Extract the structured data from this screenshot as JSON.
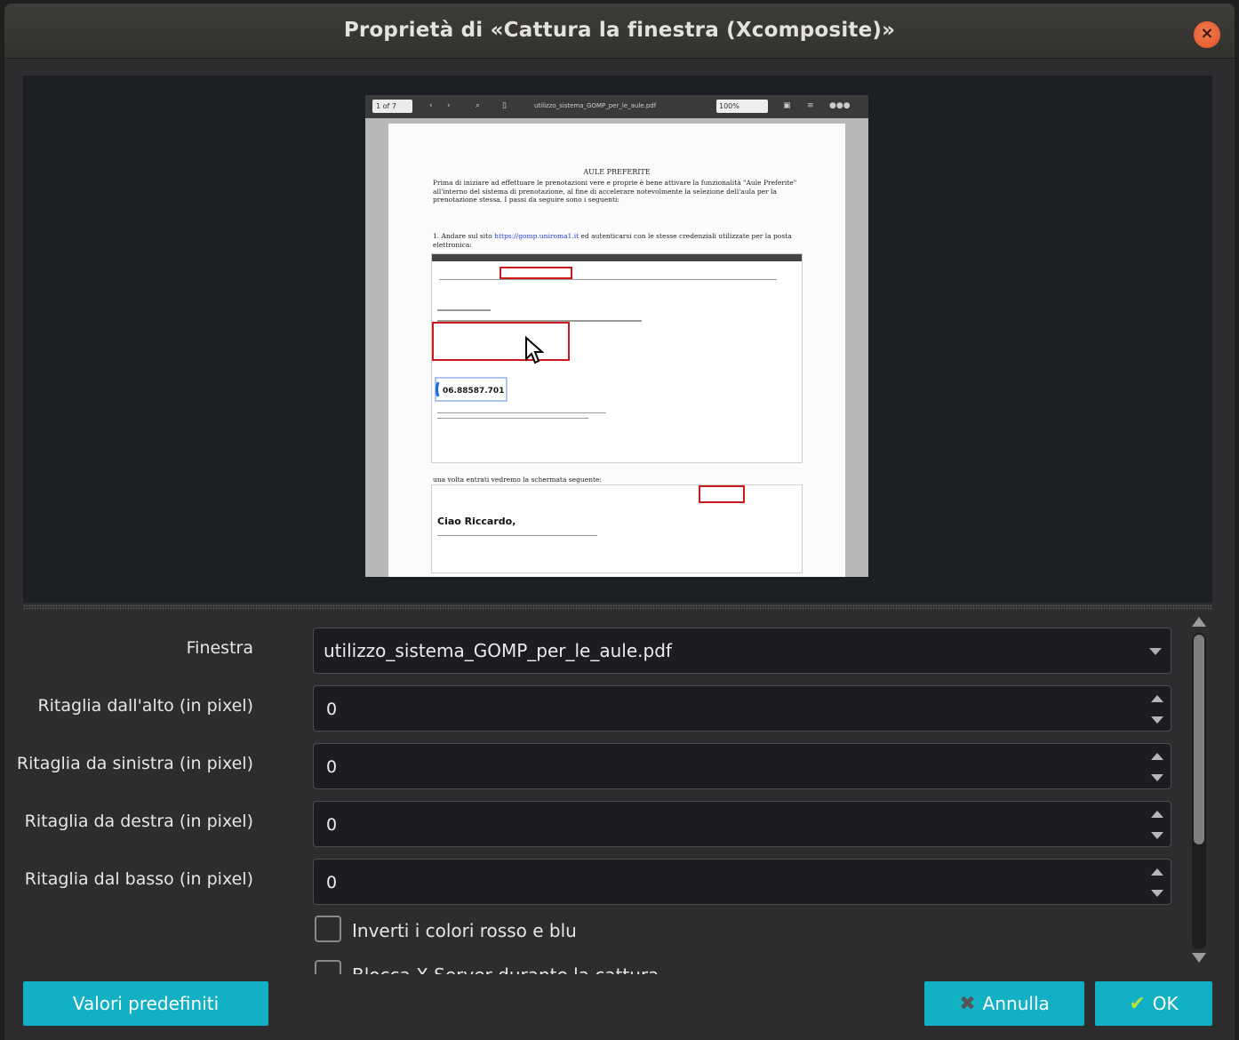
{
  "window": {
    "title": "Proprietà di «Cattura la finestra (Xcomposite)»"
  },
  "preview": {
    "toolbar": {
      "page": "1  of 7",
      "filename": "utilizzo_sistema_GOMP_per_le_aule.pdf",
      "zoom": "100%"
    },
    "document": {
      "heading": "AULE PREFERITE",
      "intro": "Prima di iniziare ad effettuare le prenotazioni vere e proprie è bene attivare la funzionalità \"Aule Preferite\" all'interno del sistema di prenotazione, al fine di accelerare notevolmente la selezione dell'aula per la prenotazione stessa. I passi da seguire sono i seguenti:",
      "step1_prefix": "1. Andare sul sito",
      "step1_link": "https://gomp.uniroma1.it",
      "step1_suffix": "ed autenticarsi con le stesse credenziali utilizzate per la posta elettronica:",
      "phone": "06.88587.701",
      "step2": "una volta entrati vedremo la schermata seguente:",
      "greeting": "Ciao Riccardo,"
    }
  },
  "form": {
    "window_label": "Finestra",
    "window_value": "utilizzo_sistema_GOMP_per_le_aule.pdf",
    "crop_top_label": "Ritaglia dall'alto (in pixel)",
    "crop_top_value": "0",
    "crop_left_label": "Ritaglia da sinistra (in pixel)",
    "crop_left_value": "0",
    "crop_right_label": "Ritaglia da destra (in pixel)",
    "crop_right_value": "0",
    "crop_bottom_label": "Ritaglia dal basso (in pixel)",
    "crop_bottom_value": "0",
    "swap_colors_label": "Inverti i colori rosso e blu",
    "lock_x_label": "Blocca X Server durante la cattura"
  },
  "buttons": {
    "defaults": "Valori predefiniti",
    "cancel": "Annulla",
    "ok": "OK"
  },
  "colors": {
    "accent": "#12b0c4",
    "close": "#e0542a",
    "background": "#2d2d30"
  }
}
